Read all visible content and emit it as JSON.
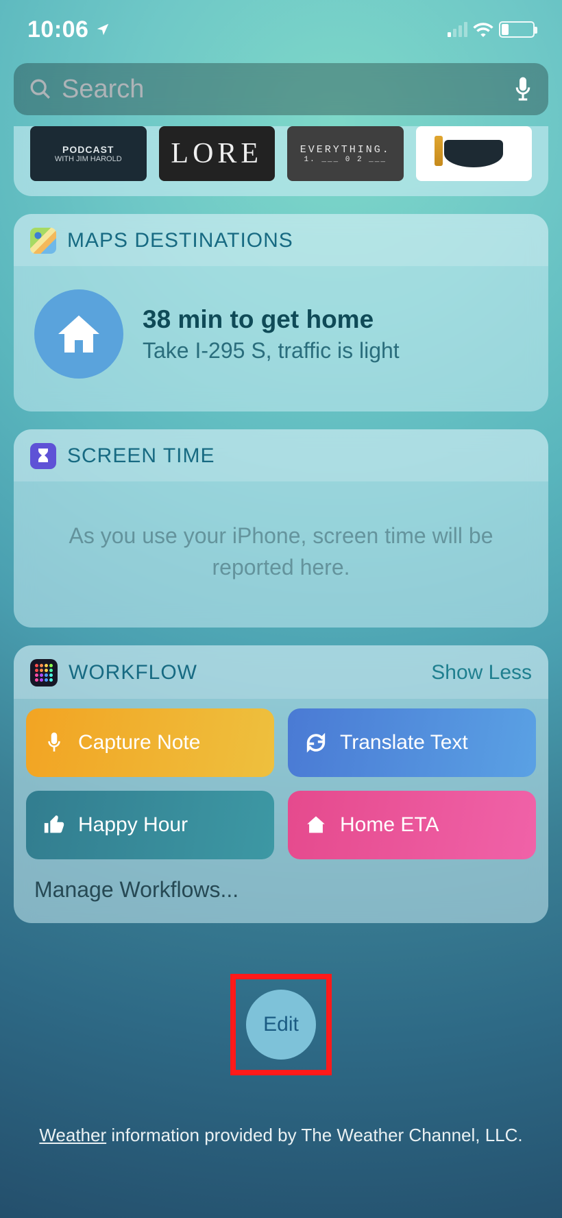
{
  "status": {
    "time": "10:06"
  },
  "search": {
    "placeholder": "Search"
  },
  "podcast_row": {
    "items": [
      {
        "line1": "PODCAST",
        "line2": "WITH JIM HAROLD"
      },
      {
        "line1": "LORE"
      },
      {
        "line1": "EVERYTHING.",
        "line2": "1. ___ 0 2 ___"
      }
    ]
  },
  "maps": {
    "header": "MAPS DESTINATIONS",
    "line1": "38 min to get home",
    "line2": "Take I-295 S, traffic is light"
  },
  "screentime": {
    "header": "SCREEN TIME",
    "message": "As you use your iPhone, screen time will be reported here."
  },
  "workflow": {
    "header": "WORKFLOW",
    "toggle": "Show Less",
    "buttons": {
      "capture": "Capture Note",
      "translate": "Translate Text",
      "happy": "Happy Hour",
      "home": "Home ETA"
    },
    "manage": "Manage Workflows..."
  },
  "edit": {
    "label": "Edit"
  },
  "footer": {
    "weather": "Weather",
    "rest": " information provided by The Weather Channel, LLC."
  }
}
